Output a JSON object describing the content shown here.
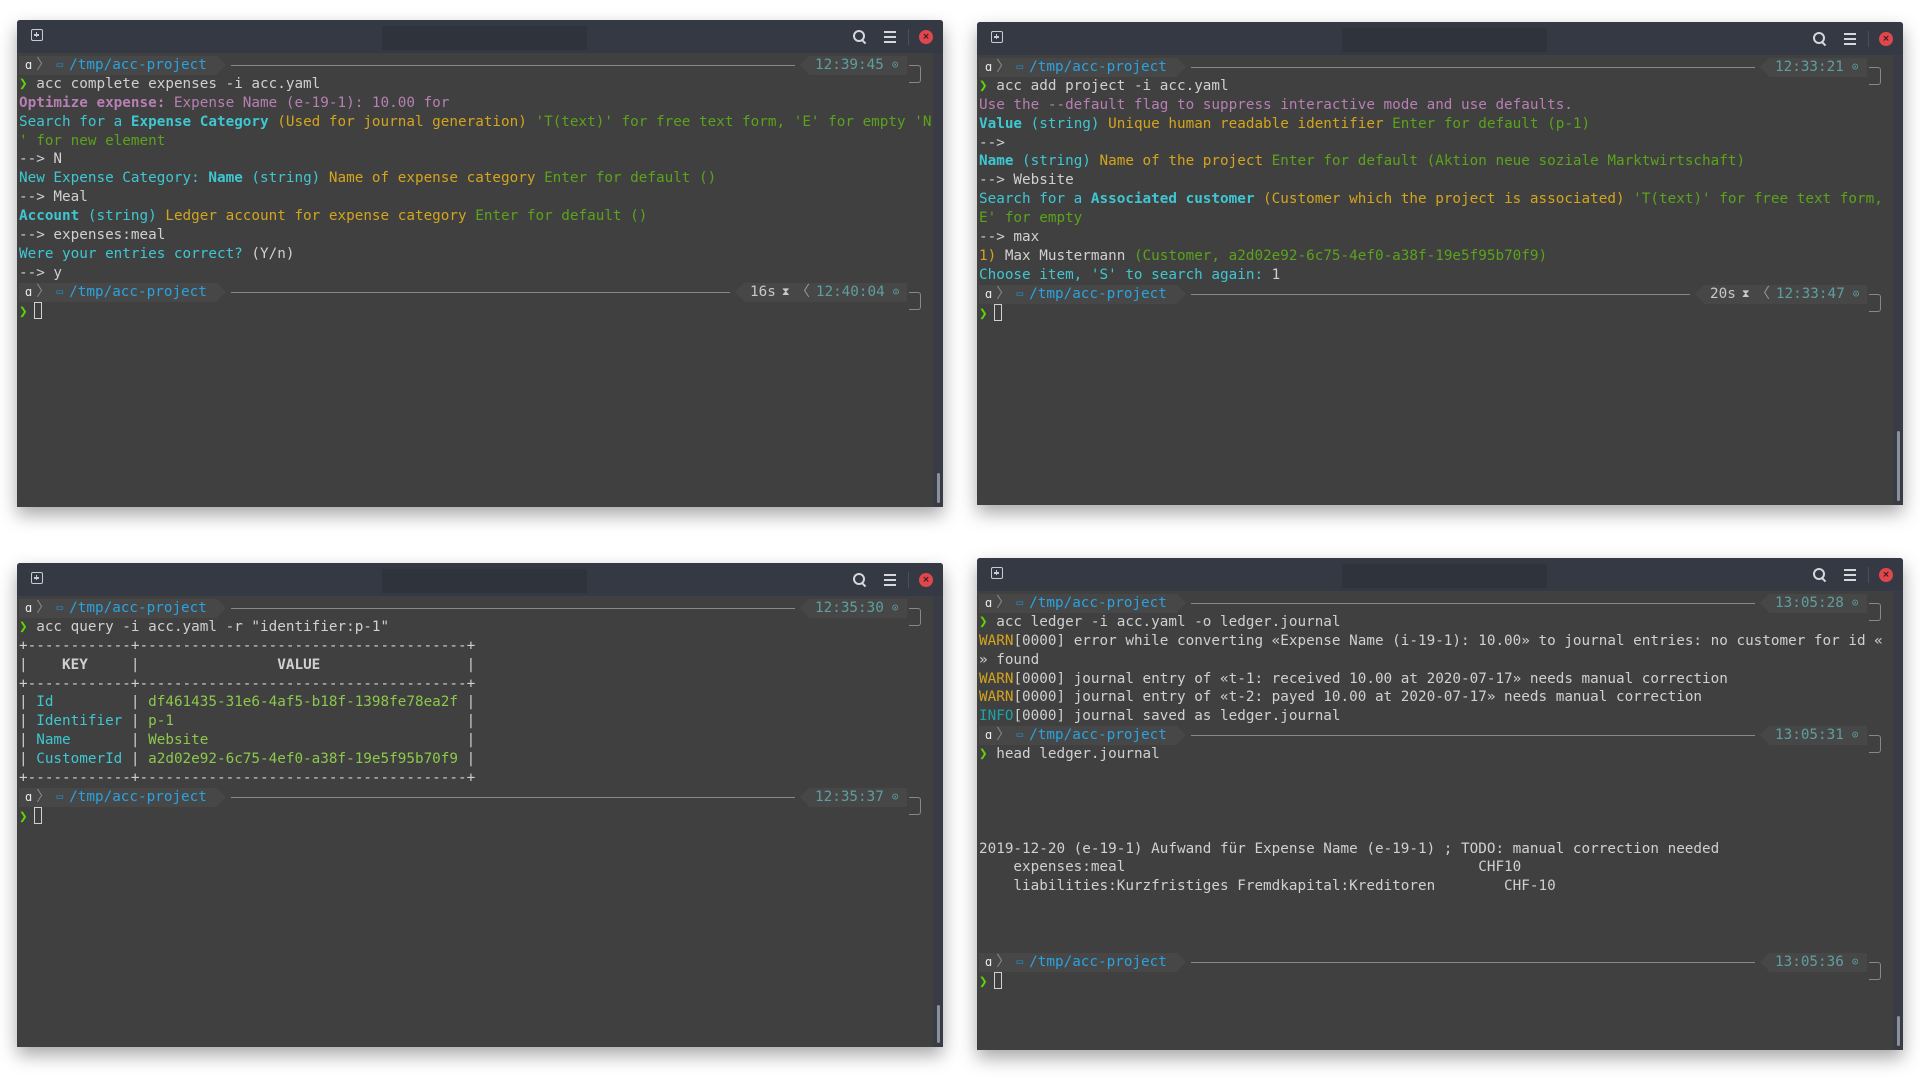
{
  "theme": {
    "prompt_color": "#5fd700",
    "dir_color": "#29a3e0",
    "time_color": "#5f9ea0",
    "close_button_color": "#e0474c",
    "terminal_bg": "#404040",
    "titlebar_bg": "#353944"
  },
  "icons": {
    "new_tab": "new-tab-icon",
    "search": "search-icon",
    "menu": "hamburger-menu-icon",
    "close": "close-icon",
    "os": "os-logo-icon",
    "folder": "folder-icon",
    "hourglass": "hourglass-icon",
    "clock": "clock-icon"
  },
  "glyphs": {
    "prompt": "❯",
    "close": "×",
    "os": "ɑ",
    "sep": "❯",
    "folder": "▭",
    "hourglass": "⧗",
    "lt": "❮",
    "clock": "⊙"
  },
  "windows": [
    {
      "blocks": [
        {
          "dir": "/tmp/acc-project",
          "time": "12:39:45",
          "command": "acc complete expenses -i acc.yaml",
          "output": [
            [
              {
                "c": "c-magenta-b",
                "t": "Optimize expense:"
              },
              {
                "c": "c-magenta",
                "t": " Expense Name (e-19-1): 10.00 for"
              }
            ],
            [
              {
                "c": "c-cyan",
                "t": "Search for a "
              },
              {
                "c": "c-cyan-b",
                "t": "Expense Category"
              },
              {
                "c": "c-yellow",
                "t": " (Used for journal generation)"
              },
              {
                "c": "c-green",
                "t": " 'T(text)' for free text form, 'E' for empty 'N"
              }
            ],
            [
              {
                "c": "c-green",
                "t": "' for new element"
              }
            ],
            [
              {
                "c": "c-white",
                "t": "--> N"
              }
            ],
            [
              {
                "c": "c-cyan",
                "t": "New Expense Category: "
              },
              {
                "c": "c-cyan-b",
                "t": "Name"
              },
              {
                "c": "c-cyan",
                "t": " (string)"
              },
              {
                "c": "c-yellow",
                "t": " Name of expense category"
              },
              {
                "c": "c-green",
                "t": " Enter for default ()"
              }
            ],
            [
              {
                "c": "c-white",
                "t": "--> Meal"
              }
            ],
            [
              {
                "c": "c-cyan-b",
                "t": "Account"
              },
              {
                "c": "c-cyan",
                "t": " (string)"
              },
              {
                "c": "c-yellow",
                "t": " Ledger account for expense category"
              },
              {
                "c": "c-green",
                "t": " Enter for default ()"
              }
            ],
            [
              {
                "c": "c-white",
                "t": "--> expenses:meal"
              }
            ],
            [
              {
                "c": "c-cyan",
                "t": "Were your entries correct?"
              },
              {
                "c": "c-white",
                "t": " (Y/n)"
              }
            ],
            [
              {
                "c": "c-white",
                "t": "--> y"
              }
            ]
          ]
        },
        {
          "dir": "/tmp/acc-project",
          "duration": "16s",
          "time": "12:40:04",
          "command": "",
          "active": true,
          "output": []
        }
      ]
    },
    {
      "blocks": [
        {
          "dir": "/tmp/acc-project",
          "time": "12:33:21",
          "command": "acc add project -i acc.yaml",
          "output": [
            [
              {
                "c": "c-magenta",
                "t": "Use the --default flag to suppress interactive mode and use defaults."
              }
            ],
            [
              {
                "c": "c-cyan-b",
                "t": "Value"
              },
              {
                "c": "c-cyan",
                "t": " (string)"
              },
              {
                "c": "c-yellow",
                "t": " Unique human readable identifier"
              },
              {
                "c": "c-green",
                "t": " Enter for default (p-1)"
              }
            ],
            [
              {
                "c": "c-white",
                "t": "-->"
              }
            ],
            [
              {
                "c": "c-cyan-b",
                "t": "Name"
              },
              {
                "c": "c-cyan",
                "t": " (string)"
              },
              {
                "c": "c-yellow",
                "t": " Name of the project"
              },
              {
                "c": "c-green",
                "t": " Enter for default (Aktion neue soziale Marktwirtschaft)"
              }
            ],
            [
              {
                "c": "c-white",
                "t": "--> Website"
              }
            ],
            [
              {
                "c": "c-cyan",
                "t": "Search for a "
              },
              {
                "c": "c-cyan-b",
                "t": "Associated customer"
              },
              {
                "c": "c-yellow",
                "t": " (Customer which the project is associated)"
              },
              {
                "c": "c-green",
                "t": " 'T(text)' for free text form, '"
              }
            ],
            [
              {
                "c": "c-green",
                "t": "E' for empty"
              }
            ],
            [
              {
                "c": "c-white",
                "t": "--> max"
              }
            ],
            [
              {
                "c": "c-yellow",
                "t": "1)"
              },
              {
                "c": "c-white",
                "t": " Max Mustermann"
              },
              {
                "c": "c-green",
                "t": " (Customer, a2d02e92-6c75-4ef0-a38f-19e5f95b70f9)"
              }
            ],
            [
              {
                "c": "c-cyan",
                "t": "Choose item, 'S' to search again:"
              },
              {
                "c": "c-white",
                "t": " 1"
              }
            ]
          ]
        },
        {
          "dir": "/tmp/acc-project",
          "duration": "20s",
          "time": "12:33:47",
          "command": "",
          "active": true,
          "output": []
        }
      ]
    },
    {
      "blocks": [
        {
          "dir": "/tmp/acc-project",
          "time": "12:35:30",
          "command": "acc query -i acc.yaml -r \"identifier:p-1\"",
          "output": [
            [
              {
                "c": "c-white",
                "t": "+------------+--------------------------------------+"
              }
            ],
            [
              {
                "c": "c-white",
                "t": "|    "
              },
              {
                "c": "c-white b",
                "t": "KEY"
              },
              {
                "c": "c-white",
                "t": "     |                "
              },
              {
                "c": "c-white b",
                "t": "VALUE"
              },
              {
                "c": "c-white",
                "t": "                 |"
              }
            ],
            [
              {
                "c": "c-white",
                "t": "+------------+--------------------------------------+"
              }
            ],
            [
              {
                "c": "c-white",
                "t": "| "
              },
              {
                "c": "c-cyan",
                "t": "Id        "
              },
              {
                "c": "c-white",
                "t": " | "
              },
              {
                "c": "c-green2",
                "t": "df461435-31e6-4af5-b18f-1398fe78ea2f"
              },
              {
                "c": "c-white",
                "t": " |"
              }
            ],
            [
              {
                "c": "c-white",
                "t": "| "
              },
              {
                "c": "c-cyan",
                "t": "Identifier"
              },
              {
                "c": "c-white",
                "t": " | "
              },
              {
                "c": "c-green2",
                "t": "p-1                                 "
              },
              {
                "c": "c-white",
                "t": " |"
              }
            ],
            [
              {
                "c": "c-white",
                "t": "| "
              },
              {
                "c": "c-cyan",
                "t": "Name      "
              },
              {
                "c": "c-white",
                "t": " | "
              },
              {
                "c": "c-green2",
                "t": "Website                             "
              },
              {
                "c": "c-white",
                "t": " |"
              }
            ],
            [
              {
                "c": "c-white",
                "t": "| "
              },
              {
                "c": "c-cyan",
                "t": "CustomerId"
              },
              {
                "c": "c-white",
                "t": " | "
              },
              {
                "c": "c-green2",
                "t": "a2d02e92-6c75-4ef0-a38f-19e5f95b70f9"
              },
              {
                "c": "c-white",
                "t": " |"
              }
            ],
            [
              {
                "c": "c-white",
                "t": "+------------+--------------------------------------+"
              }
            ]
          ],
          "table": {
            "headers": [
              "KEY",
              "VALUE"
            ],
            "rows": [
              {
                "key": "Id",
                "value": "df461435-31e6-4af5-b18f-1398fe78ea2f"
              },
              {
                "key": "Identifier",
                "value": "p-1"
              },
              {
                "key": "Name",
                "value": "Website"
              },
              {
                "key": "CustomerId",
                "value": "a2d02e92-6c75-4ef0-a38f-19e5f95b70f9"
              }
            ]
          }
        },
        {
          "dir": "/tmp/acc-project",
          "time": "12:35:37",
          "command": "",
          "active": true,
          "output": []
        }
      ]
    },
    {
      "blocks": [
        {
          "dir": "/tmp/acc-project",
          "time": "13:05:28",
          "command": "acc ledger -i acc.yaml -o ledger.journal",
          "output": [
            [
              {
                "c": "c-warn",
                "t": "WARN"
              },
              {
                "c": "c-white",
                "t": "[0000] error while converting «Expense Name (i-19-1): 10.00» to journal entries: no customer for id «"
              }
            ],
            [
              {
                "c": "c-white",
                "t": "» found"
              }
            ],
            [
              {
                "c": "c-warn",
                "t": "WARN"
              },
              {
                "c": "c-white",
                "t": "[0000] journal entry of «t-1: received 10.00 at 2020-07-17» needs manual correction"
              }
            ],
            [
              {
                "c": "c-warn",
                "t": "WARN"
              },
              {
                "c": "c-white",
                "t": "[0000] journal entry of «t-2: payed 10.00 at 2020-07-17» needs manual correction"
              }
            ],
            [
              {
                "c": "c-info",
                "t": "INFO"
              },
              {
                "c": "c-white",
                "t": "[0000] journal saved as ledger.journal"
              }
            ]
          ]
        },
        {
          "dir": "/tmp/acc-project",
          "time": "13:05:31",
          "command": "head ledger.journal",
          "output": [
            [
              {
                "c": "c-white",
                "t": ""
              }
            ],
            [
              {
                "c": "c-white",
                "t": ""
              }
            ],
            [
              {
                "c": "c-white",
                "t": ""
              }
            ],
            [
              {
                "c": "c-white",
                "t": ""
              }
            ],
            [
              {
                "c": "c-white",
                "t": "2019-12-20 (e-19-1) Aufwand für Expense Name (e-19-1) ; TODO: manual correction needed"
              }
            ],
            [
              {
                "c": "c-white",
                "t": "    expenses:meal                                         CHF10"
              }
            ],
            [
              {
                "c": "c-white",
                "t": "    liabilities:Kurzfristiges Fremdkapital:Kreditoren        CHF-10"
              }
            ],
            [
              {
                "c": "c-white",
                "t": ""
              }
            ],
            [
              {
                "c": "c-white",
                "t": ""
              }
            ],
            [
              {
                "c": "c-white",
                "t": ""
              }
            ]
          ]
        },
        {
          "dir": "/tmp/acc-project",
          "time": "13:05:36",
          "command": "",
          "active": true,
          "output": []
        }
      ]
    }
  ]
}
